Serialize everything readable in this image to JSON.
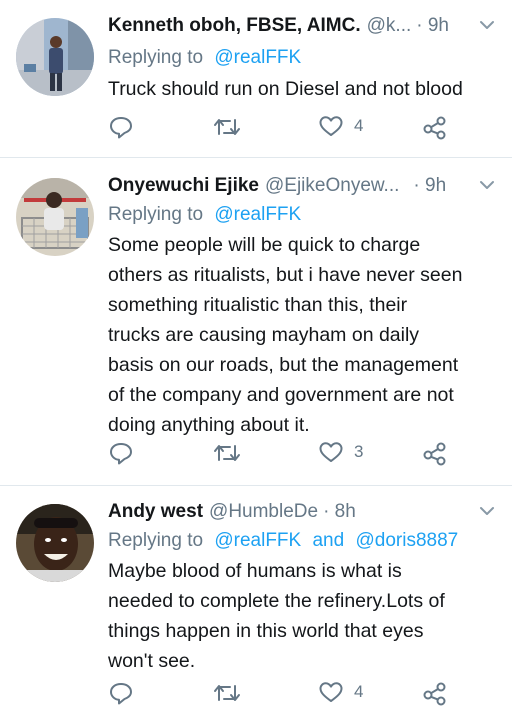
{
  "tweets": [
    {
      "name": "Kenneth oboh, FBSE, AIMC.",
      "handle": "@k...",
      "time": "· 9h",
      "replying_prefix": "Replying to",
      "mentions": [
        "@realFFK"
      ],
      "text_lines": [
        "Truck should run on Diesel and not blood"
      ],
      "like_count": "4",
      "avatar_colors": {
        "bg": "#9fb6cf",
        "figure": "#3c4c6e",
        "street": "#c9ced6"
      }
    },
    {
      "name": "Onyewuchi Ejike",
      "handle": "@EjikeOnyew...",
      "time": "· 9h",
      "replying_prefix": "Replying to",
      "mentions": [
        "@realFFK"
      ],
      "text_lines": [
        "Some people will be quick to charge",
        "others as ritualists, but i have never seen",
        "something ritualistic than this, their",
        "trucks are causing mayham on daily",
        "basis on our roads, but the management",
        "of the company and government are not",
        "doing anything about it."
      ],
      "like_count": "3",
      "avatar_colors": {
        "bg": "#d8d2c4",
        "figure": "#3b2a22",
        "shirt": "#e9e9e9"
      }
    },
    {
      "name": "Andy west",
      "handle": "@HumbleDe",
      "time": "· 8h",
      "replying_prefix": "Replying to",
      "mentions": [
        "@realFFK",
        "@doris8887"
      ],
      "mention_joiner": "and",
      "text_lines": [
        "Maybe blood of humans is what is",
        "needed to complete the refinery.Lots of",
        "things happen in this world that eyes",
        "won't see."
      ],
      "like_count": "4",
      "avatar_colors": {
        "bg": "#5a4a36",
        "face": "#3a2418",
        "teeth": "#f4f0e6"
      }
    }
  ],
  "colors": {
    "link": "#1da1f2",
    "muted": "#657786",
    "text": "#14171a",
    "divider": "#e1e8ed"
  },
  "icons": [
    "reply-icon",
    "retweet-icon",
    "like-icon",
    "share-icon",
    "chevron-down-icon"
  ]
}
